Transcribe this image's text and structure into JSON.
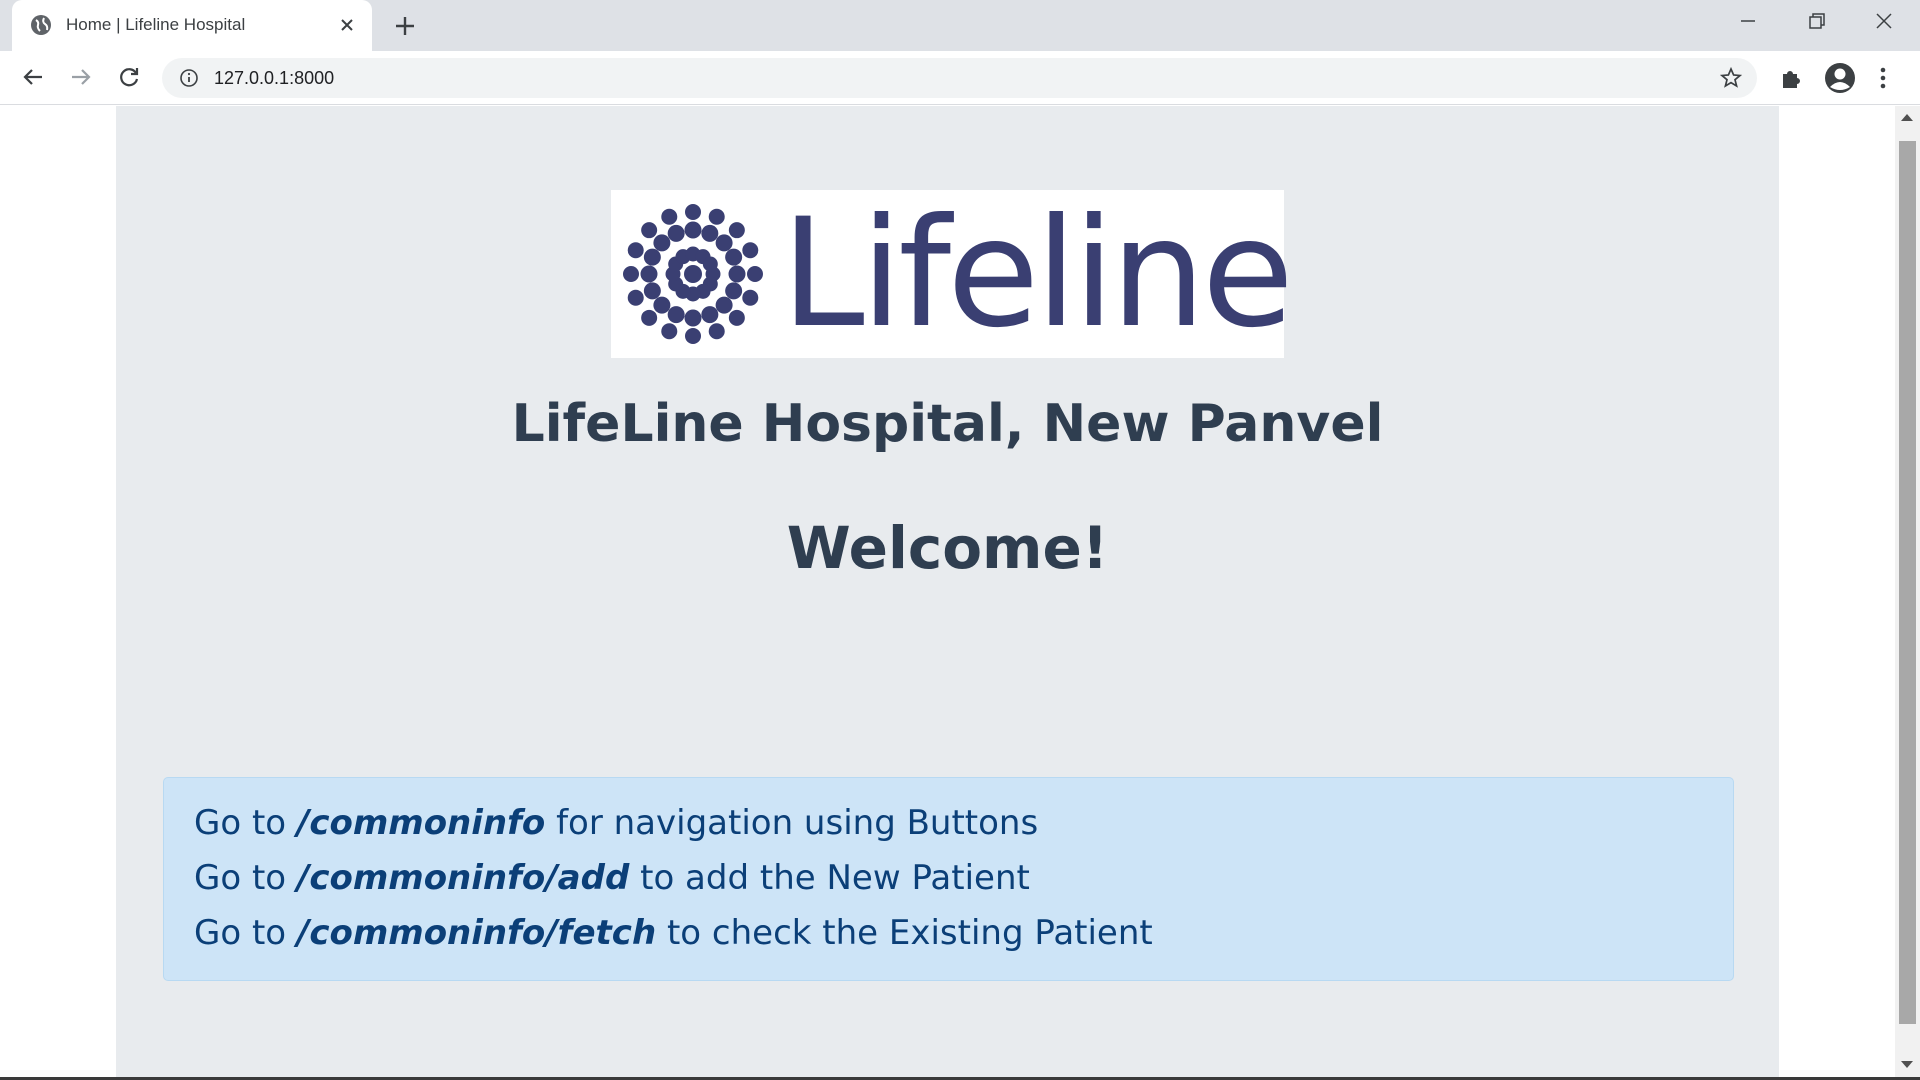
{
  "browser": {
    "tab": {
      "title": "Home | Lifeline Hospital",
      "favicon": "globe-icon",
      "close_icon": "close-icon"
    },
    "new_tab_icon": "plus-icon",
    "window_controls": [
      "minimize-icon",
      "restore-icon",
      "close-icon"
    ],
    "nav": {
      "back_icon": "back-arrow-icon",
      "forward_icon": "forward-arrow-icon",
      "reload_icon": "reload-icon"
    },
    "address_bar": {
      "info_icon": "info-icon",
      "url": "127.0.0.1:8000",
      "bookmark_icon": "star-icon"
    },
    "extensions_icon": "puzzle-icon",
    "profile_icon": "account-icon",
    "menu_icon": "kebab-menu-icon"
  },
  "page": {
    "logo": {
      "text": "Lifeline",
      "color": "#3a3f72"
    },
    "heading": "LifeLine Hospital, New Panvel",
    "welcome": "Welcome!",
    "info": [
      {
        "prefix": "Go to ",
        "path": "/commoninfo",
        "suffix": " for navigation using Buttons"
      },
      {
        "prefix": "Go to ",
        "path": "/commoninfo/add",
        "suffix": " to add the New Patient"
      },
      {
        "prefix": "Go to ",
        "path": "/commoninfo/fetch",
        "suffix": " to check the Existing Patient"
      }
    ]
  },
  "colors": {
    "page_bg": "#e8ebee",
    "heading": "#2f3e50",
    "info_bg": "#cde4f7",
    "info_text": "#0b3f78"
  }
}
